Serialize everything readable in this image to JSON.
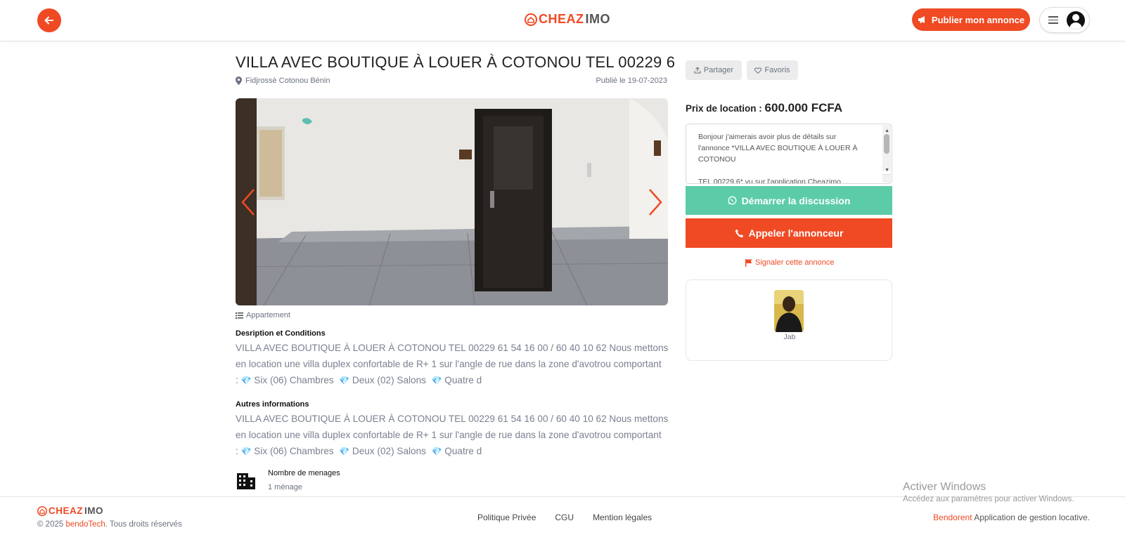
{
  "header": {
    "logo_prefix": "CHEAZ",
    "logo_suffix": "IMO",
    "publish_label": "Publier mon annonce"
  },
  "listing": {
    "title": "VILLA AVEC BOUTIQUE À LOUER À COTONOU TEL 00229 6",
    "location": "Fidjrossè Cotonou Bénin",
    "published": "Publié le 19-07-2023",
    "category": "Appartement",
    "description_title": "Desription et Conditions",
    "description_lines": [
      "VILLA AVEC BOUTIQUE À LOUER À COTONOU TEL 00229 61 54 16 00 / 60 40 10 62 Nous mettons",
      "en location une villa duplex confortable de R+ 1 sur l'angle de rue dans la zone d'avotrou comportant"
    ],
    "description_items": [
      ": ",
      "Six (06) Chambres",
      "Deux (02) Salons",
      "Quatre d"
    ],
    "other_title": "Autres informations",
    "other_lines": [
      "VILLA AVEC BOUTIQUE À LOUER À COTONOU TEL 00229 61 54 16 00 / 60 40 10 62 Nous mettons",
      "en location une villa duplex confortable de R+ 1 sur l'angle de rue dans la zone d'avotrou comportant"
    ],
    "other_items": [
      ": ",
      "Six (06) Chambres",
      "Deux (02) Salons",
      "Quatre d"
    ],
    "menages_label": "Nombre de menages",
    "menages_value": "1 ménage"
  },
  "sidebar": {
    "share_label": "Partager",
    "favorite_label": "Favoris",
    "price_label": "Prix de location : ",
    "price_value": "600.000 FCFA",
    "message_lines": [
      "Bonjour j'aimerais avoir plus de détails sur",
      "l'annonce *VILLA AVEC BOUTIQUE À LOUER À",
      "COTONOU",
      "",
      "TEL 00229 6* vu sur l'application Cheazimo"
    ],
    "whatsapp_label": "Démarrer la discussion",
    "call_label": "Appeler l'annonceur",
    "report_label": "Signaler cette annonce",
    "owner_name": "Jab"
  },
  "footer": {
    "logo_prefix": "CHEAZ",
    "logo_suffix": "IMO",
    "copyright_prefix": "© 2025 ",
    "copyright_brand": "bendoTech",
    "copyright_suffix": ". Tous droits réservés",
    "links": [
      "Politique Privée",
      "CGU",
      "Mention légales"
    ],
    "brand_name": "Bendorent",
    "brand_tagline": " Application de gestion locative."
  },
  "watermark": {
    "line1": "Activer Windows",
    "line2": "Accédez aux paramètres pour activer Windows."
  },
  "colors": {
    "accent": "#f04a24",
    "whatsapp": "#5ccba7",
    "muted_text": "#6b7280"
  },
  "icons": [
    "arrow-left-icon",
    "house-logo-icon",
    "megaphone-icon",
    "menu-icon",
    "user-avatar-icon",
    "map-pin-icon",
    "chevron-left-icon",
    "chevron-right-icon",
    "list-icon",
    "share-icon",
    "heart-icon",
    "whatsapp-icon",
    "phone-icon",
    "flag-icon",
    "building-icon",
    "gem-icon"
  ]
}
